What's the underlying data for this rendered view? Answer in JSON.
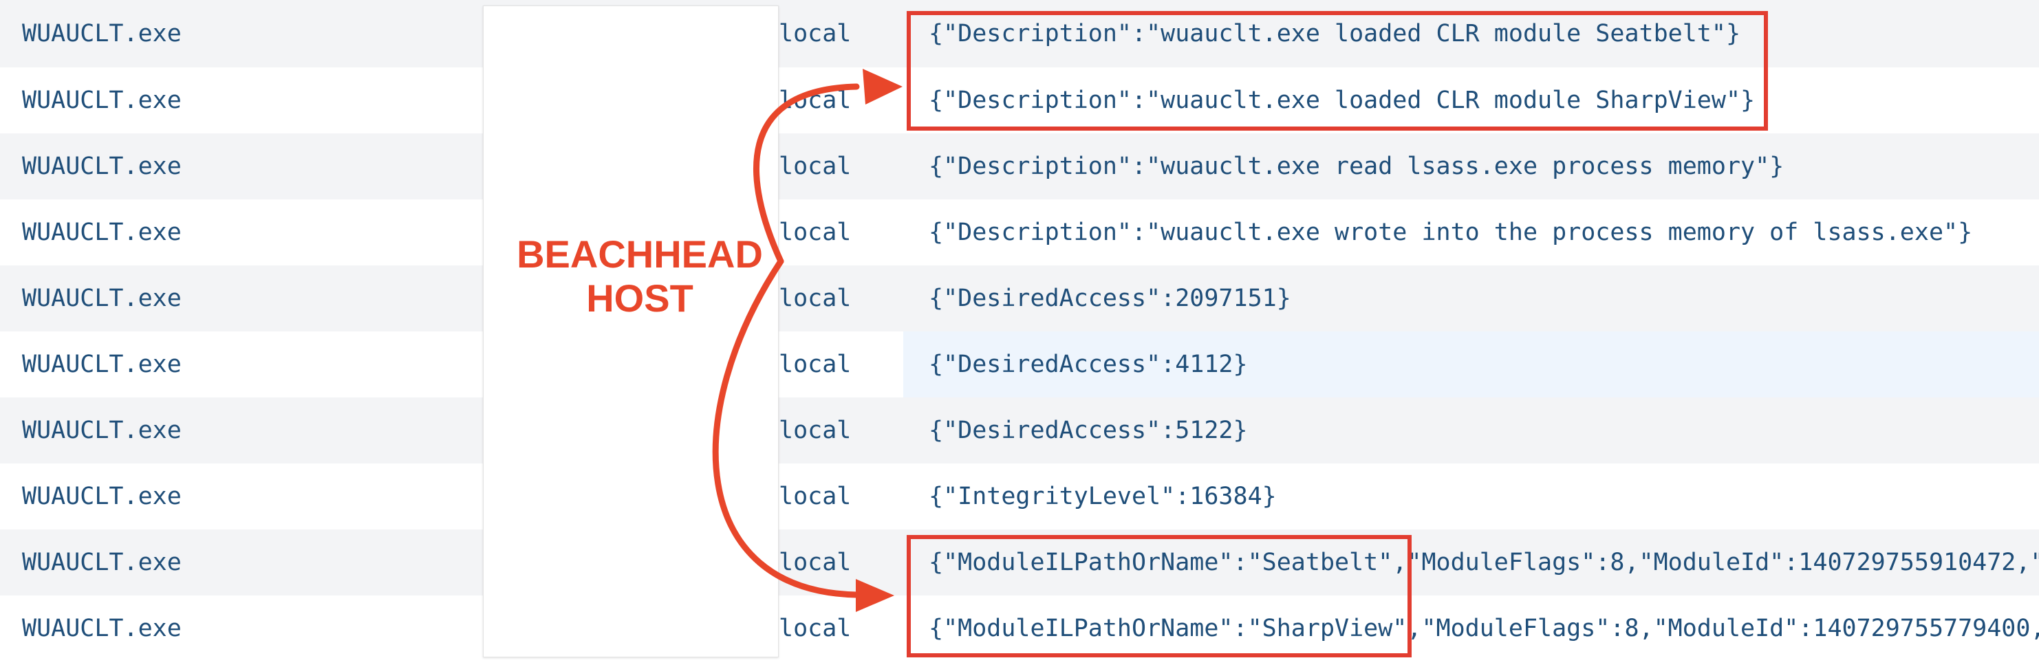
{
  "rows": [
    {
      "process": "WUAUCLT.exe",
      "host": "local",
      "data": "{\"Description\":\"wuauclt.exe loaded CLR module Seatbelt\"}"
    },
    {
      "process": "WUAUCLT.exe",
      "host": "local",
      "data": "{\"Description\":\"wuauclt.exe loaded CLR module SharpView\"}"
    },
    {
      "process": "WUAUCLT.exe",
      "host": "local",
      "data": "{\"Description\":\"wuauclt.exe read lsass.exe process memory\"}"
    },
    {
      "process": "WUAUCLT.exe",
      "host": "local",
      "data": "{\"Description\":\"wuauclt.exe wrote into the process memory of lsass.exe\"}"
    },
    {
      "process": "WUAUCLT.exe",
      "host": "local",
      "data": "{\"DesiredAccess\":2097151}"
    },
    {
      "process": "WUAUCLT.exe",
      "host": "local",
      "data": "{\"DesiredAccess\":4112}"
    },
    {
      "process": "WUAUCLT.exe",
      "host": "local",
      "data": "{\"DesiredAccess\":5122}"
    },
    {
      "process": "WUAUCLT.exe",
      "host": "local",
      "data": "{\"IntegrityLevel\":16384}"
    },
    {
      "process": "WUAUCLT.exe",
      "host": "local",
      "data": "{\"ModuleILPathOrName\":\"Seatbelt\",\"ModuleFlags\":8,\"ModuleId\":140729755910472,\""
    },
    {
      "process": "WUAUCLT.exe",
      "host": "local",
      "data": "{\"ModuleILPathOrName\":\"SharpView\",\"ModuleFlags\":8,\"ModuleId\":140729755779400,"
    }
  ],
  "annotation": {
    "label_line1": "BEACHHEAD",
    "label_line2": "HOST",
    "color": "#e23d30"
  },
  "colors": {
    "text": "#1f4e79",
    "row_alt": "#f3f4f6",
    "row_highlight": "#eef5fd"
  }
}
